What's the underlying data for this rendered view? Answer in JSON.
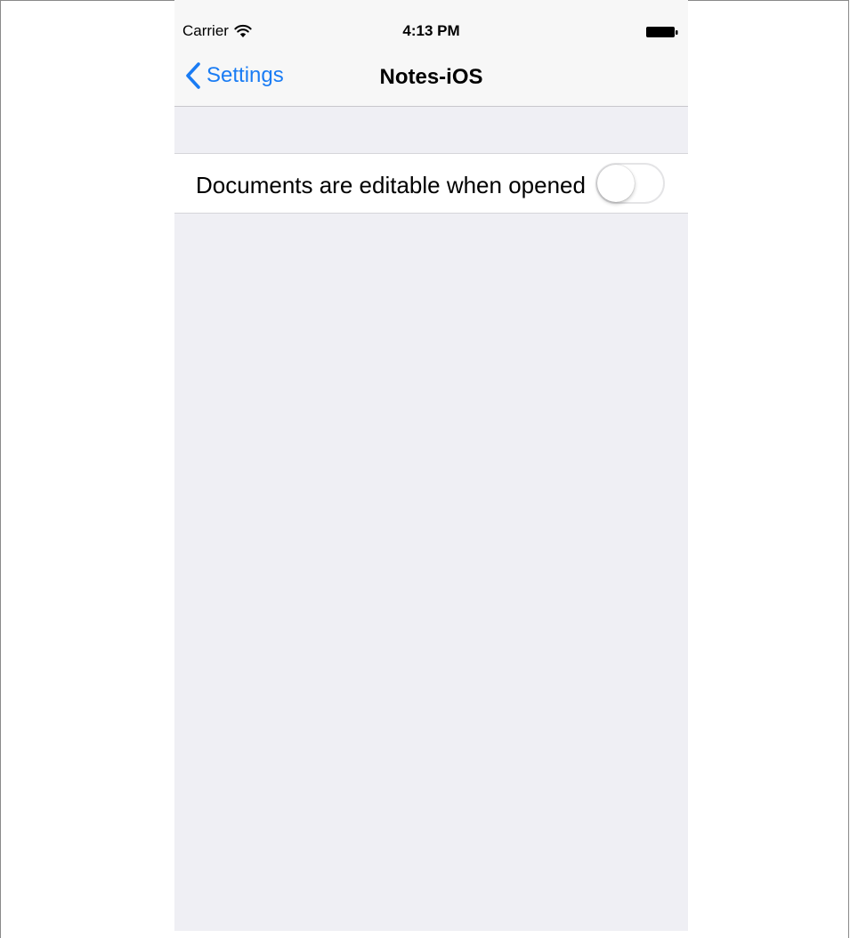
{
  "status_bar": {
    "carrier": "Carrier",
    "time": "4:13 PM",
    "icons": [
      "wifi-icon",
      "battery-icon"
    ]
  },
  "nav_bar": {
    "back_label": "Settings",
    "title": "Notes-iOS"
  },
  "settings": {
    "rows": [
      {
        "label": "Documents are editable when opened",
        "type": "toggle",
        "value": false
      }
    ]
  },
  "colors": {
    "accent": "#1a7cf4",
    "background": "#efeff4",
    "bar": "#f7f7f7"
  }
}
